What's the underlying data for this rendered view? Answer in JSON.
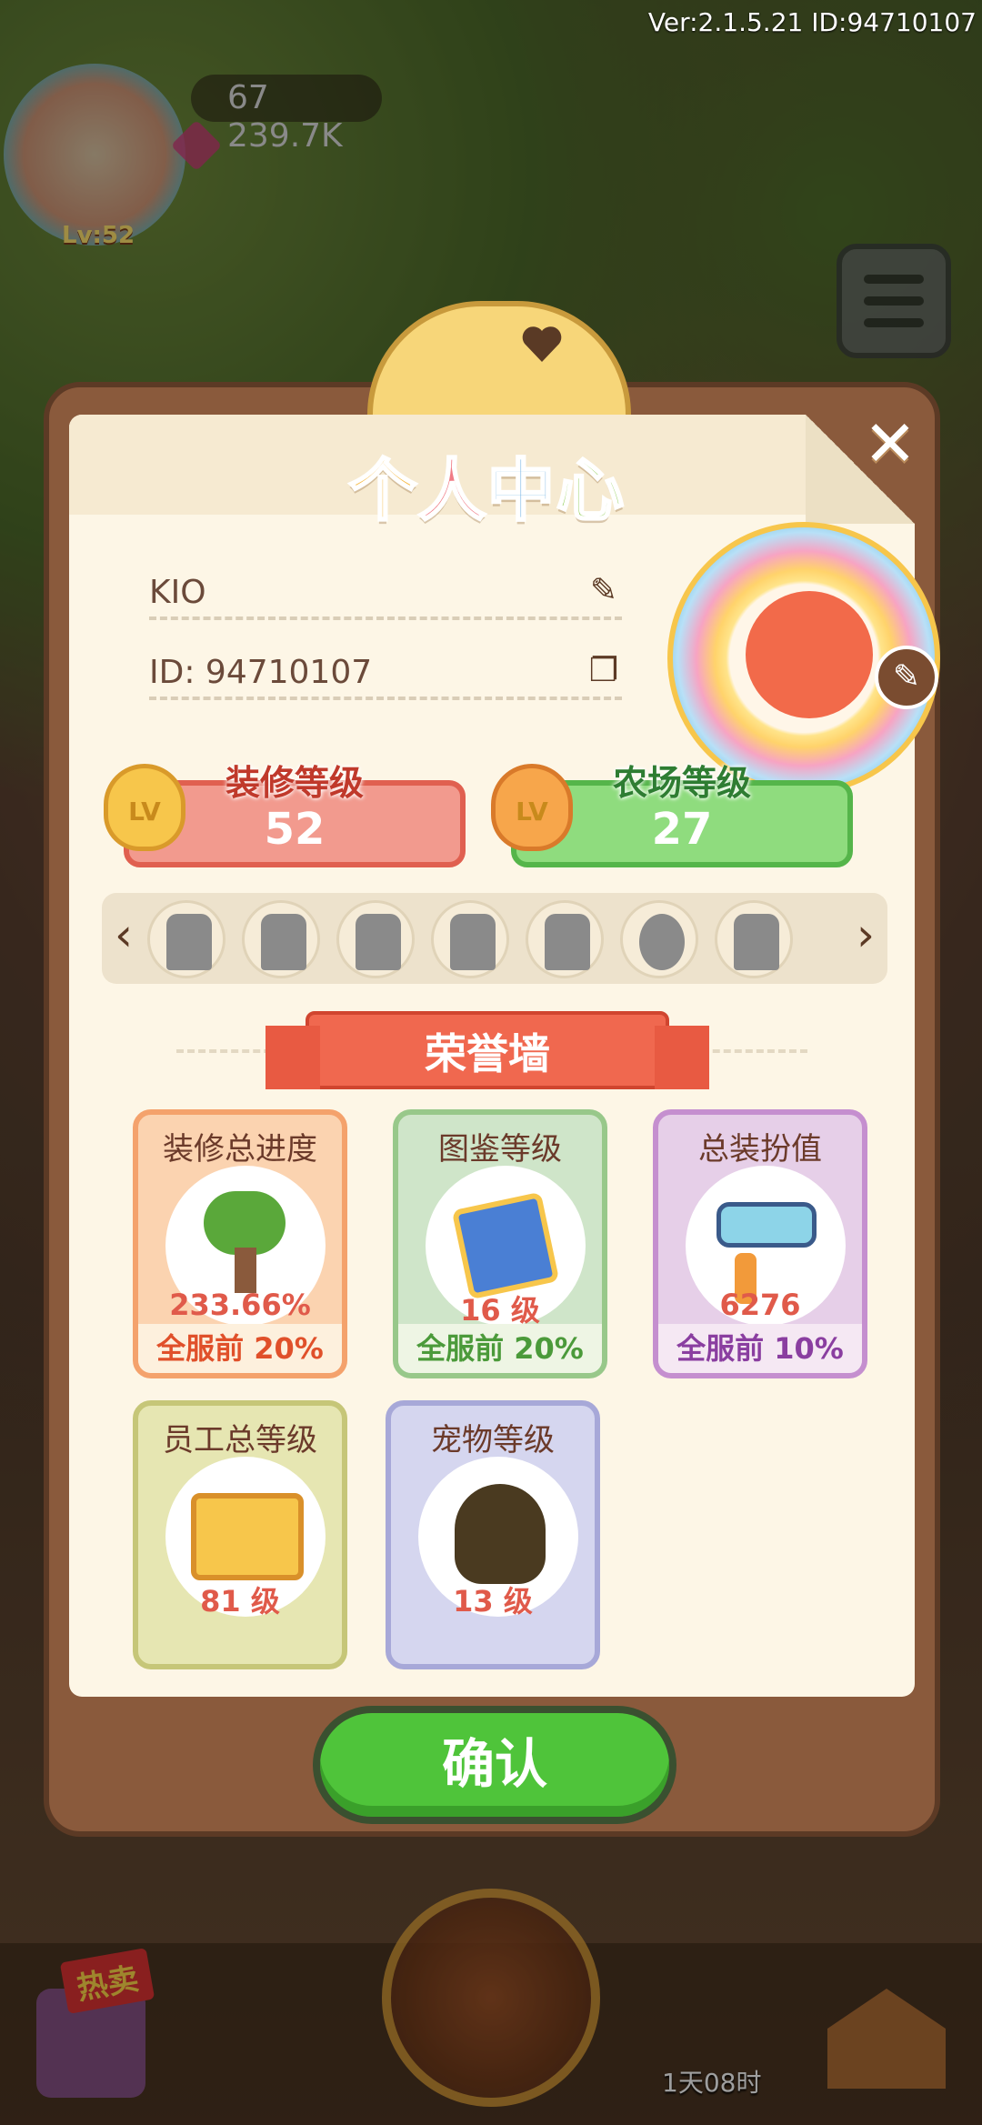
{
  "status": {
    "version": "Ver:2.1.5.21 ID:94710107"
  },
  "hud": {
    "player_level": "Lv:52",
    "gems": "67",
    "acorns": "239.7K",
    "hot_label": "热卖",
    "timer": "1天08时"
  },
  "dialog": {
    "title_chars": [
      "个",
      "人",
      "中",
      "心"
    ],
    "nickname": "KIO",
    "id_text": "ID: 94710107",
    "decoration_level": {
      "label": "装修等级",
      "value": "52",
      "badge": "LV"
    },
    "farm_level": {
      "label": "农场等级",
      "value": "27",
      "badge": "LV"
    },
    "honor_title": "荣誉墙",
    "cards": [
      {
        "title": "装修总进度",
        "value": "233.66%",
        "rank": "全服前 20%"
      },
      {
        "title": "图鉴等级",
        "value": "16 级",
        "rank": "全服前 20%"
      },
      {
        "title": "总装扮值",
        "value": "6276",
        "rank": "全服前 10%"
      },
      {
        "title": "员工总等级",
        "value": "81 级"
      },
      {
        "title": "宠物等级",
        "value": "13 级"
      }
    ],
    "confirm_label": "确认"
  },
  "icons": {
    "edit": "pencil-icon",
    "copy": "copy-icon",
    "close": "close-icon",
    "prev": "chevron-left-icon",
    "next": "chevron-right-icon"
  },
  "colors": {
    "confirm_green": "#4fc43a",
    "decoration_red": "#f29a8e",
    "farm_green": "#8fdc7e",
    "honor_red": "#f0684f",
    "frame_brown": "#8a5a3c"
  }
}
